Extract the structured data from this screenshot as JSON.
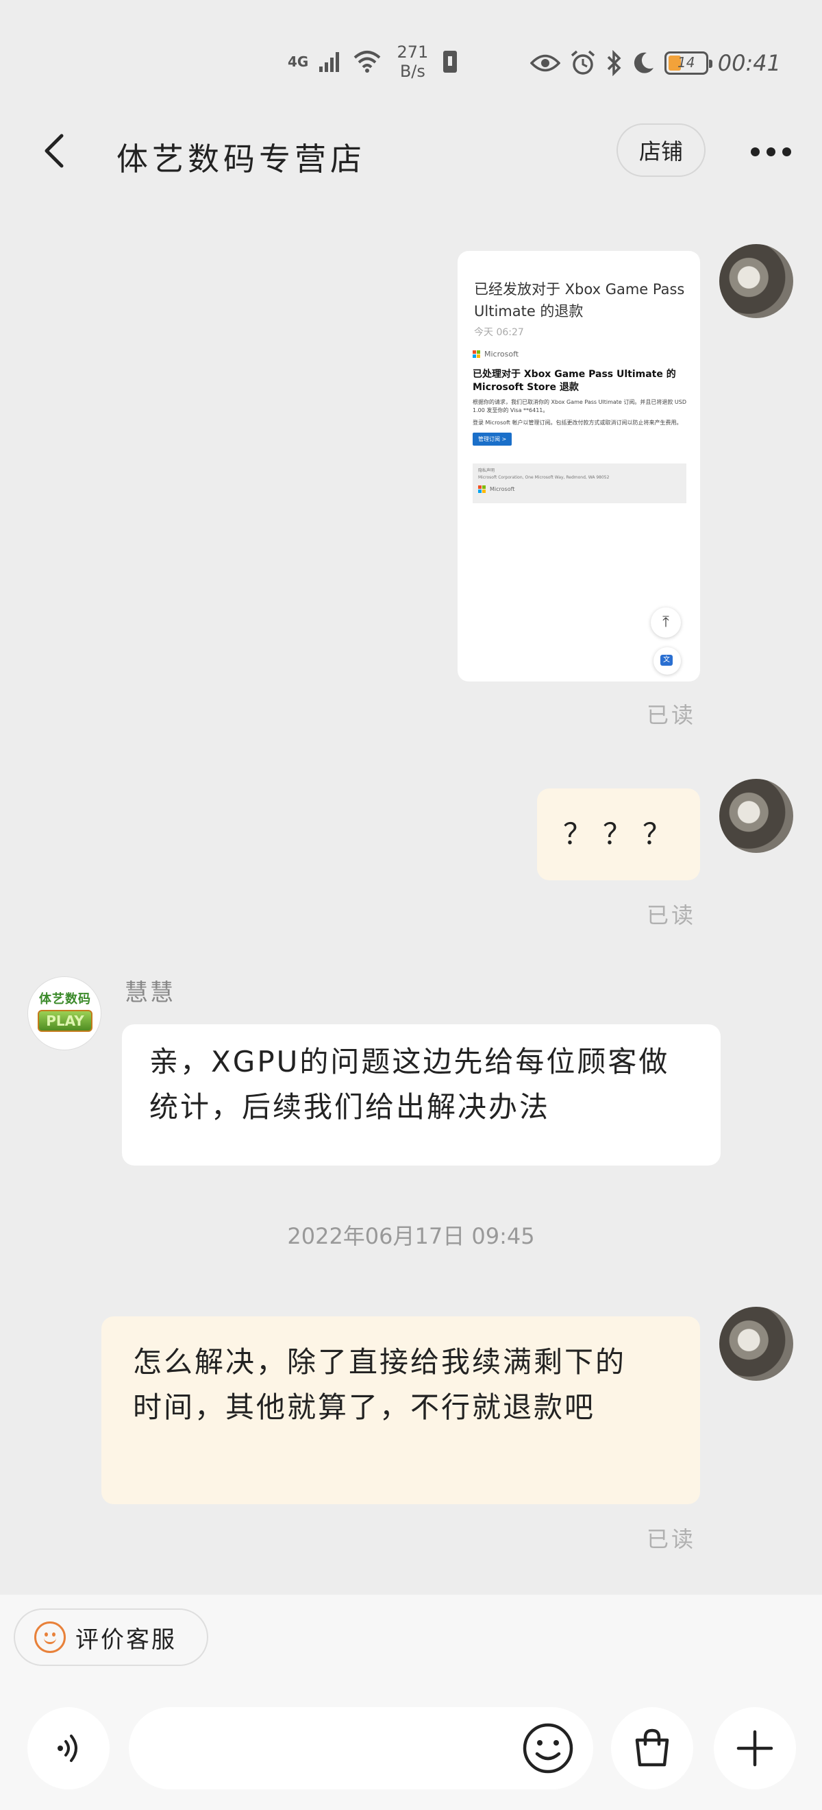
{
  "status_bar": {
    "network": "4G",
    "speed_value": "271",
    "speed_unit": "B/s",
    "battery": "14",
    "time": "00:41"
  },
  "header": {
    "title": "体艺数码专营店",
    "shop_button": "店铺"
  },
  "messages": {
    "screenshot": {
      "heading": "已经发放对于 Xbox Game Pass Ultimate 的退款",
      "date": "今天 06:27",
      "mail_brand": "Microsoft",
      "mail_title": "已处理对于 Xbox Game Pass Ultimate 的 Microsoft Store 退款",
      "mail_body_1": "根据你的请求，我们已取消你的 Xbox Game Pass Ultimate 订阅。并且已将退款 USD 1.00 发至你的 Visa **6411。",
      "mail_body_2": "登录 Microsoft 帐户以管理订阅。包括更改付款方式或取消订阅以防止将来产生费用。",
      "mail_button": "管理订阅 >",
      "footer_line_1": "隐私声明",
      "footer_line_2": "Microsoft Corporation, One Microsoft Way, Redmond, WA 98052",
      "footer_brand": "Microsoft"
    },
    "read_label": "已读",
    "question": "？？？",
    "shop_sender": "慧慧",
    "shop_reply": "亲，XGPU的问题这边先给每位顾客做统计，后续我们给出解决办法",
    "timestamp": "2022年06月17日 09:45",
    "my_reply": "怎么解决，除了直接给我续满剩下的时间，其他就算了，不行就退款吧"
  },
  "shop_logo": {
    "top": "体艺数码",
    "bottom": "PLAY"
  },
  "bottom_bar": {
    "rate_service": "评价客服"
  },
  "icons": {
    "back": "chevron-left-icon",
    "more": "more-dots-icon",
    "voice": "voice-icon",
    "emoji": "smile-icon",
    "bag": "shopping-bag-icon",
    "plus": "plus-icon"
  },
  "colors": {
    "background": "#ededed",
    "my_bubble": "#fdf5e6",
    "shop_bubble": "#ffffff",
    "accent_orange": "#e8813a"
  }
}
